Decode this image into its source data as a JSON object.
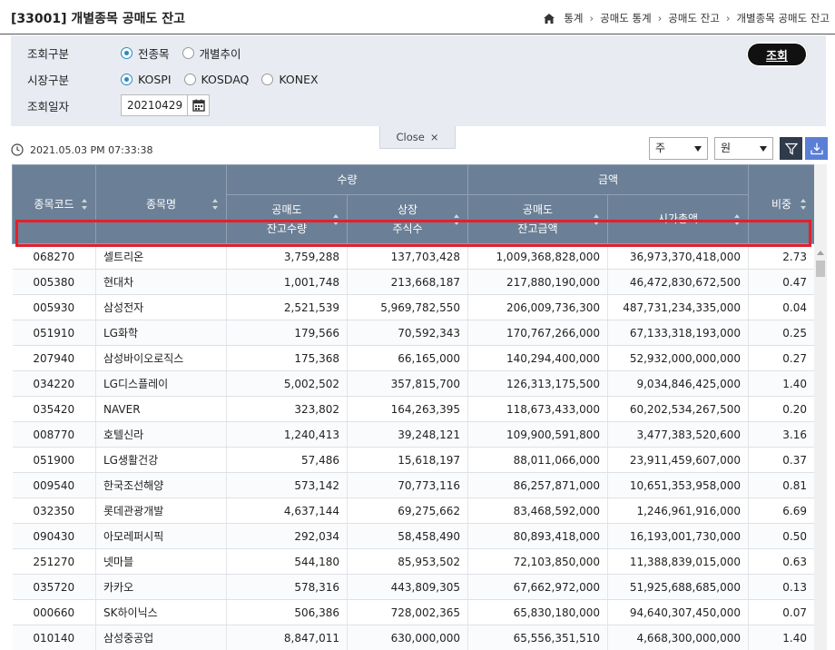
{
  "header": {
    "title": "[33001] 개별종목 공매도 잔고",
    "breadcrumb": [
      "통계",
      "공매도 통계",
      "공매도 잔고",
      "개별종목 공매도 잔고"
    ]
  },
  "search": {
    "query_type_label": "조회구분",
    "query_type_options": [
      {
        "label": "전종목",
        "checked": true
      },
      {
        "label": "개별추이",
        "checked": false
      }
    ],
    "market_label": "시장구분",
    "market_options": [
      {
        "label": "KOSPI",
        "checked": true
      },
      {
        "label": "KOSDAQ",
        "checked": false
      },
      {
        "label": "KONEX",
        "checked": false
      }
    ],
    "date_label": "조회일자",
    "date_value": "20210429",
    "search_button": "조회",
    "close_label": "Close",
    "close_symbol": "×"
  },
  "toolbar": {
    "timestamp": "2021.05.03 PM 07:33:38",
    "unit_share": "주",
    "unit_currency": "원"
  },
  "table": {
    "headers": {
      "code": "종목코드",
      "name": "종목명",
      "quantity_group": "수량",
      "amount_group": "금액",
      "short_qty": "공매도\n잔고수량",
      "listed_shares": "상장\n주식수",
      "short_amount": "공매도\n잔고금액",
      "market_cap": "시가총액",
      "ratio": "비중"
    },
    "rows": [
      [
        "068270",
        "셀트리온",
        "3,759,288",
        "137,703,428",
        "1,009,368,828,000",
        "36,973,370,418,000",
        "2.73"
      ],
      [
        "005380",
        "현대차",
        "1,001,748",
        "213,668,187",
        "217,880,190,000",
        "46,472,830,672,500",
        "0.47"
      ],
      [
        "005930",
        "삼성전자",
        "2,521,539",
        "5,969,782,550",
        "206,009,736,300",
        "487,731,234,335,000",
        "0.04"
      ],
      [
        "051910",
        "LG화학",
        "179,566",
        "70,592,343",
        "170,767,266,000",
        "67,133,318,193,000",
        "0.25"
      ],
      [
        "207940",
        "삼성바이오로직스",
        "175,368",
        "66,165,000",
        "140,294,400,000",
        "52,932,000,000,000",
        "0.27"
      ],
      [
        "034220",
        "LG디스플레이",
        "5,002,502",
        "357,815,700",
        "126,313,175,500",
        "9,034,846,425,000",
        "1.40"
      ],
      [
        "035420",
        "NAVER",
        "323,802",
        "164,263,395",
        "118,673,433,000",
        "60,202,534,267,500",
        "0.20"
      ],
      [
        "008770",
        "호텔신라",
        "1,240,413",
        "39,248,121",
        "109,900,591,800",
        "3,477,383,520,600",
        "3.16"
      ],
      [
        "051900",
        "LG생활건강",
        "57,486",
        "15,618,197",
        "88,011,066,000",
        "23,911,459,607,000",
        "0.37"
      ],
      [
        "009540",
        "한국조선해양",
        "573,142",
        "70,773,116",
        "86,257,871,000",
        "10,651,353,958,000",
        "0.81"
      ],
      [
        "032350",
        "롯데관광개발",
        "4,637,144",
        "69,275,662",
        "83,468,592,000",
        "1,246,961,916,000",
        "6.69"
      ],
      [
        "090430",
        "아모레퍼시픽",
        "292,034",
        "58,458,490",
        "80,893,418,000",
        "16,193,001,730,000",
        "0.50"
      ],
      [
        "251270",
        "넷마블",
        "544,180",
        "85,953,502",
        "72,103,850,000",
        "11,388,839,015,000",
        "0.63"
      ],
      [
        "035720",
        "카카오",
        "578,316",
        "443,809,305",
        "67,662,972,000",
        "51,925,688,685,000",
        "0.13"
      ],
      [
        "000660",
        "SK하이닉스",
        "506,386",
        "728,002,365",
        "65,830,180,000",
        "94,640,307,450,000",
        "0.07"
      ],
      [
        "010140",
        "삼성중공업",
        "8,847,011",
        "630,000,000",
        "65,556,351,510",
        "4,668,300,000,000",
        "1.40"
      ]
    ]
  },
  "colors": {
    "header_bg": "#6b7f96",
    "highlight": "#e3202b",
    "panel_bg": "#e8ecf2",
    "accent": "#2a8bbf"
  }
}
